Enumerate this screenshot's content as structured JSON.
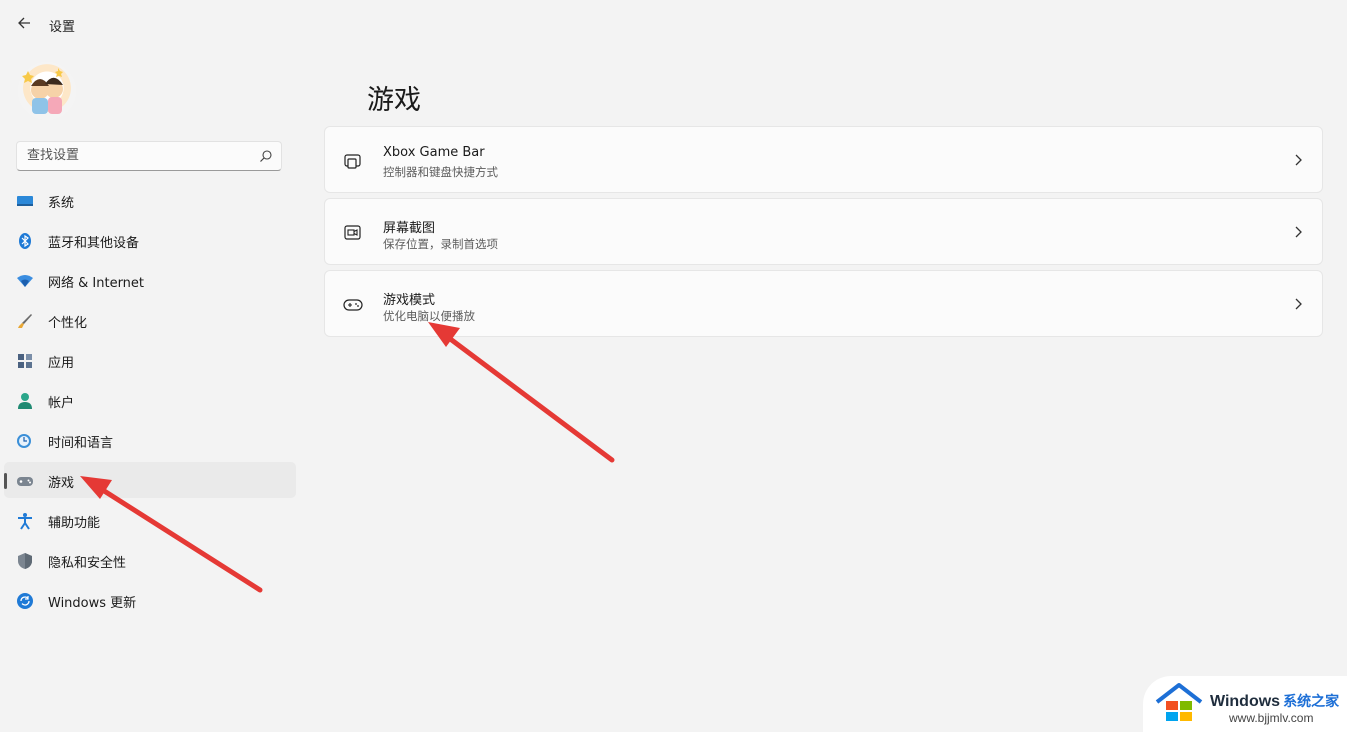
{
  "titlebar": {
    "title": "设置",
    "back_icon": "back-arrow-icon"
  },
  "search": {
    "placeholder": "查找设置"
  },
  "sidebar": {
    "items": [
      {
        "label": "系统",
        "icon": "system-icon",
        "active": false
      },
      {
        "label": "蓝牙和其他设备",
        "icon": "bluetooth-icon",
        "active": false
      },
      {
        "label": "网络 & Internet",
        "icon": "wifi-icon",
        "active": false
      },
      {
        "label": "个性化",
        "icon": "brush-icon",
        "active": false
      },
      {
        "label": "应用",
        "icon": "apps-icon",
        "active": false
      },
      {
        "label": "帐户",
        "icon": "account-icon",
        "active": false
      },
      {
        "label": "时间和语言",
        "icon": "time-language-icon",
        "active": false
      },
      {
        "label": "游戏",
        "icon": "gamepad-icon",
        "active": true
      },
      {
        "label": "辅助功能",
        "icon": "accessibility-icon",
        "active": false
      },
      {
        "label": "隐私和安全性",
        "icon": "shield-icon",
        "active": false
      },
      {
        "label": "Windows 更新",
        "icon": "update-icon",
        "active": false
      }
    ]
  },
  "main": {
    "title": "游戏",
    "cards": [
      {
        "title": "Xbox Game Bar",
        "subtitle": "控制器和键盘快捷方式",
        "icon": "game-bar-icon"
      },
      {
        "title": "屏幕截图",
        "subtitle": "保存位置，录制首选项",
        "icon": "capture-icon"
      },
      {
        "title": "游戏模式",
        "subtitle": "优化电脑以便播放",
        "icon": "game-mode-icon"
      }
    ]
  },
  "watermark": {
    "brand": "Windows",
    "brand_cn": "系统之家",
    "url": "www.bjjmlv.com"
  },
  "colors": {
    "accent": "#0067c0",
    "arrow": "#e53935",
    "background": "#f3f3f3",
    "card": "#fbfbfb"
  }
}
